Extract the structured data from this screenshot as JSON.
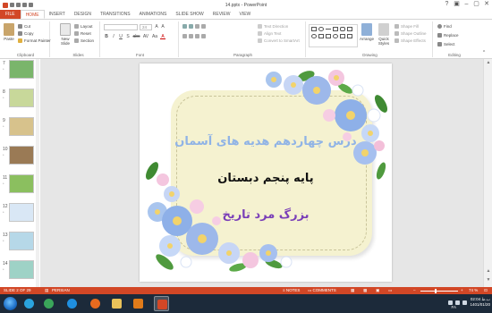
{
  "window": {
    "title": "14.pptx - PowerPoint",
    "controls": [
      "?",
      "▣",
      "–",
      "▢",
      "✕"
    ]
  },
  "tabs": [
    "FILE",
    "HOME",
    "INSERT",
    "DESIGN",
    "TRANSITIONS",
    "ANIMATIONS",
    "SLIDE SHOW",
    "REVIEW",
    "VIEW"
  ],
  "active_tab": "HOME",
  "ribbon": {
    "clipboard": {
      "label": "Clipboard",
      "paste": "Paste",
      "cut": "Cut",
      "copy": "Copy",
      "format_painter": "Format Painter"
    },
    "slides": {
      "label": "Slides",
      "new_slide": "New Slide",
      "layout": "Layout",
      "reset": "Reset",
      "section": "Section"
    },
    "font": {
      "label": "Font",
      "font_size": "24",
      "buttons": [
        "B",
        "I",
        "U",
        "S",
        "abc",
        "AV",
        "Aa",
        "A"
      ]
    },
    "paragraph": {
      "label": "Paragraph",
      "text_direction": "Text Direction",
      "align_text": "Align Text",
      "convert_smartart": "Convert to SmartArt"
    },
    "drawing": {
      "label": "Drawing",
      "arrange": "Arrange",
      "quick_styles": "Quick Styles",
      "shape_fill": "Shape Fill",
      "shape_outline": "Shape Outline",
      "shape_effects": "Shape Effects"
    },
    "editing": {
      "label": "Editing",
      "find": "Find",
      "replace": "Replace",
      "select": "Select"
    }
  },
  "thumbnails": [
    "7",
    "8",
    "9",
    "10",
    "11",
    "12",
    "13",
    "14"
  ],
  "thumbnail_colors": [
    "#7ab56b",
    "#c8d89a",
    "#d7c28c",
    "#9a7a55",
    "#8bbf5f",
    "#d9e7f5",
    "#b6d8e8",
    "#9ed2c6"
  ],
  "slide": {
    "title": "درس چهاردهم هدیه های آسمان",
    "line1": "پایه پنجم دبستان",
    "line2": "بزرگ مرد تاریخ"
  },
  "status": {
    "slide_of": "SLIDE 2 OF 29",
    "language": "PERSIAN",
    "notes": "NOTES",
    "comments": "COMMENTS",
    "zoom": "74 %"
  },
  "taskbar": {
    "time": "02:04 ب.ظ",
    "date": "1401/01/20",
    "language": "FA"
  },
  "colors": {
    "accent": "#d24726",
    "taskbar": "#1c2a3a"
  }
}
